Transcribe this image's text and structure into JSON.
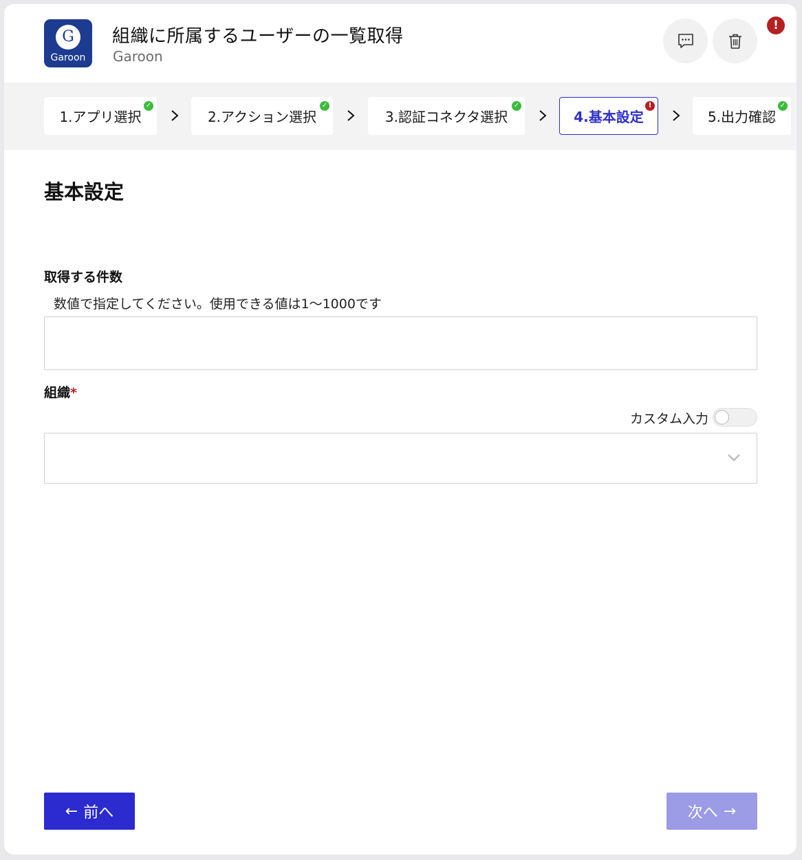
{
  "header": {
    "title": "組織に所属するユーザーの一覧取得",
    "app_name": "Garoon",
    "logo_letter": "G",
    "logo_word": "Garoon",
    "comment_icon": "comment-icon",
    "trash_icon": "trash-icon",
    "alert_symbol": "!"
  },
  "steps": [
    {
      "label": "1.アプリ選択",
      "status": "ok"
    },
    {
      "label": "2.アクション選択",
      "status": "ok"
    },
    {
      "label": "3.認証コネクタ選択",
      "status": "ok"
    },
    {
      "label": "4.基本設定",
      "status": "error",
      "active": true
    },
    {
      "label": "5.出力確認",
      "status": "ok"
    }
  ],
  "status_symbols": {
    "ok": "✓",
    "error": "!"
  },
  "main": {
    "section_title": "基本設定",
    "count_field": {
      "label": "取得する件数",
      "hint": "数値で指定してください。使用できる値は1〜1000です",
      "value": ""
    },
    "org_field": {
      "label": "組織",
      "required_mark": "*",
      "custom_input_label": "カスタム入力",
      "custom_input_enabled": false,
      "selected": ""
    }
  },
  "nav": {
    "prev_arrow": "←",
    "prev_label": "前へ",
    "next_label": "次へ",
    "next_arrow": "→"
  },
  "colors": {
    "accent": "#2b2bcf",
    "accent_disabled": "#9b9be6",
    "error": "#b52020",
    "success": "#3dbb3d",
    "brand": "#1d3b8f"
  }
}
